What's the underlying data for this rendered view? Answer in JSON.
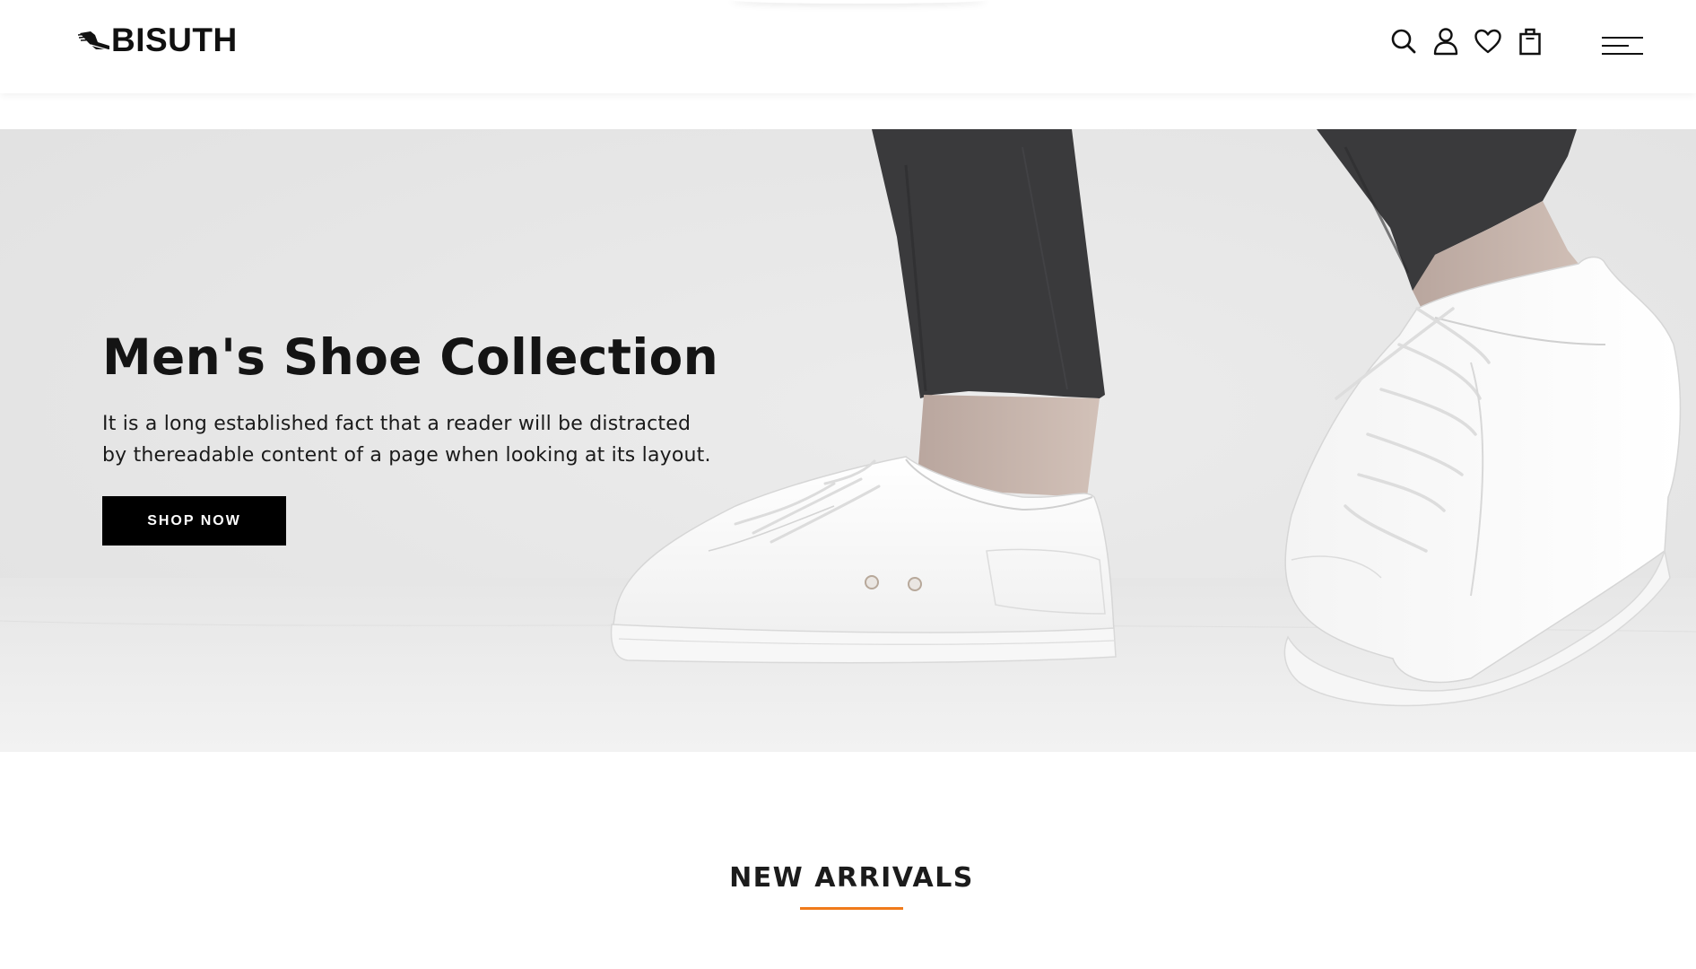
{
  "brand": {
    "name": "BISUTH"
  },
  "header": {
    "icons": [
      "search-icon",
      "user-icon",
      "heart-icon",
      "shopping-bag-icon",
      "menu-icon"
    ]
  },
  "hero": {
    "title": "Men's Shoe Collection",
    "description": "It is a long established fact that a reader will be distracted by thereadable content of a page when looking at its layout.",
    "button_label": "SHOP NOW"
  },
  "new_arrivals": {
    "title": "NEW ARRIVALS"
  },
  "colors": {
    "text": "#111111",
    "button_bg": "#000000",
    "button_text": "#ffffff",
    "accent": "#f07a1a",
    "hero_bg": "#e6e6e6"
  }
}
